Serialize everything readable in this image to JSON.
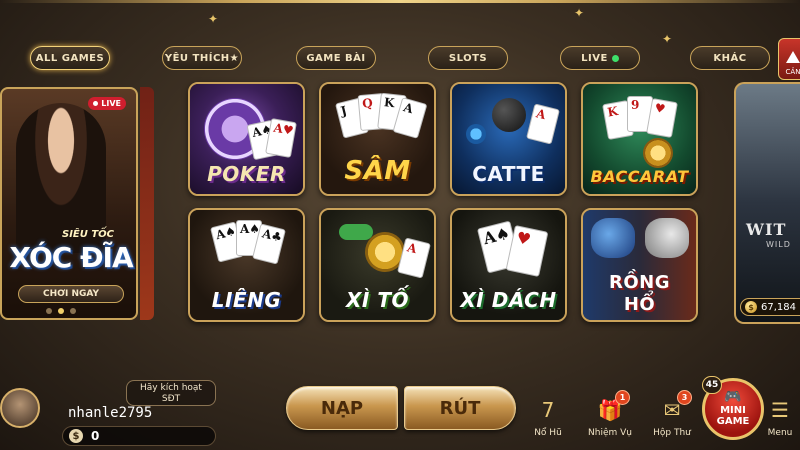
{
  "tabs": [
    {
      "label": "ALL GAMES"
    },
    {
      "label": "YÊU THÍCH★"
    },
    {
      "label": "GAME BÀI"
    },
    {
      "label": "SLOTS"
    },
    {
      "label": "LIVE"
    },
    {
      "label": "KHÁC"
    }
  ],
  "corner_button": {
    "label": "CẢN"
  },
  "featured": {
    "live_badge": "LIVE",
    "subtitle": "SIÊU TỐC",
    "title": "XÓC ĐĨA",
    "button": "CHƠI NGAY"
  },
  "games": [
    {
      "label": "POKER"
    },
    {
      "label": "SÂM"
    },
    {
      "label": "CATTE"
    },
    {
      "label": "BACCARAT"
    },
    {
      "label": "LIÊNG"
    },
    {
      "label": "XÌ TỐ"
    },
    {
      "label": "XÌ DÁCH"
    },
    {
      "label": "RỒNG HỔ"
    }
  ],
  "side_game": {
    "title": "WIT",
    "subtitle": "WILD",
    "jackpot": "67,184"
  },
  "user": {
    "activate_line1": "Hãy kích hoạt",
    "activate_line2": "SĐT",
    "username": "nhanle2795",
    "balance": "0",
    "currency_symbol": "$"
  },
  "actions": {
    "deposit": "NẠP",
    "withdraw": "RÚT"
  },
  "nav": {
    "no_hu": "Nổ Hũ",
    "nhiem_vu": "Nhiệm Vụ",
    "nhiem_vu_badge": "1",
    "hop_thu": "Hộp Thư",
    "hop_thu_badge": "3",
    "minigame_line1": "MINI",
    "minigame_line2": "GAME",
    "minigame_badge": "45",
    "menu": "Menu"
  },
  "colors": {
    "accent_gold": "#c9a45a",
    "live_red": "#d01e2e",
    "live_green": "#3ee06a"
  }
}
